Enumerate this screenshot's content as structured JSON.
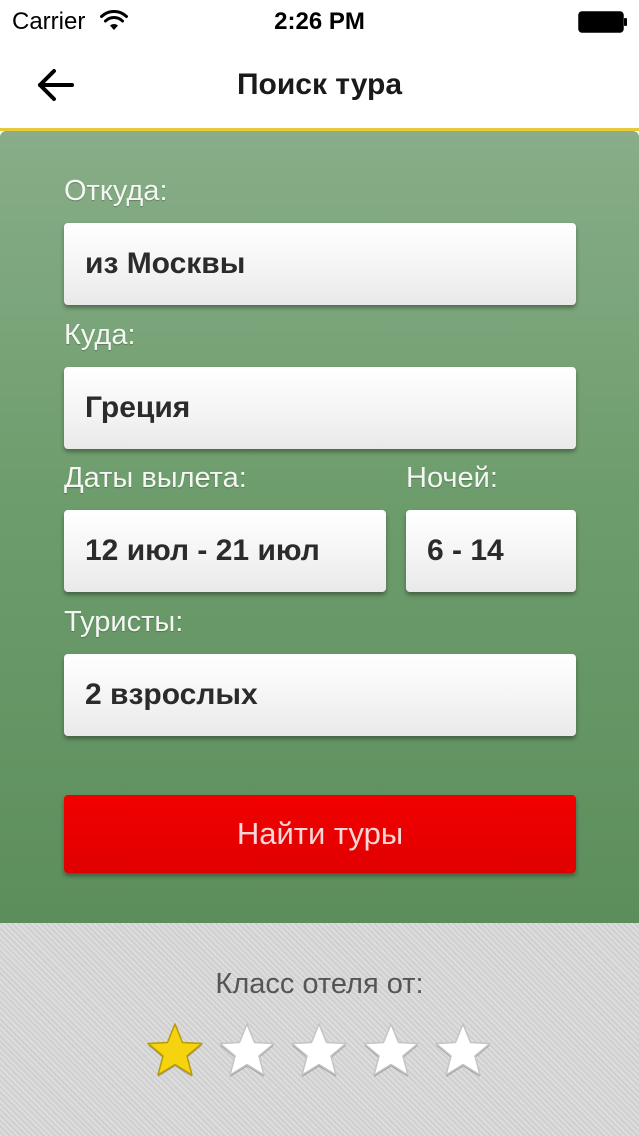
{
  "status_bar": {
    "carrier": "Carrier",
    "time": "2:26 PM"
  },
  "nav": {
    "title": "Поиск тура",
    "back_icon": "arrow-left-icon"
  },
  "form": {
    "from": {
      "label": "Откуда:",
      "value": "из Москвы"
    },
    "to": {
      "label": "Куда:",
      "value": "Греция"
    },
    "dates": {
      "label": "Даты вылета:",
      "value": "12 июл - 21 июл"
    },
    "nights": {
      "label": "Ночей:",
      "value": "6 - 14"
    },
    "tourists": {
      "label": "Туристы:",
      "value": "2 взрослых"
    },
    "search_button": "Найти туры"
  },
  "hotel_class": {
    "label": "Класс отеля от:",
    "selected": 1,
    "max": 5
  },
  "colors": {
    "accent_yellow": "#e8c93a",
    "form_green": "#6e9d6d",
    "button_red": "#e60000",
    "star_selected": "#f5d40f",
    "star_unselected": "#ffffff"
  }
}
